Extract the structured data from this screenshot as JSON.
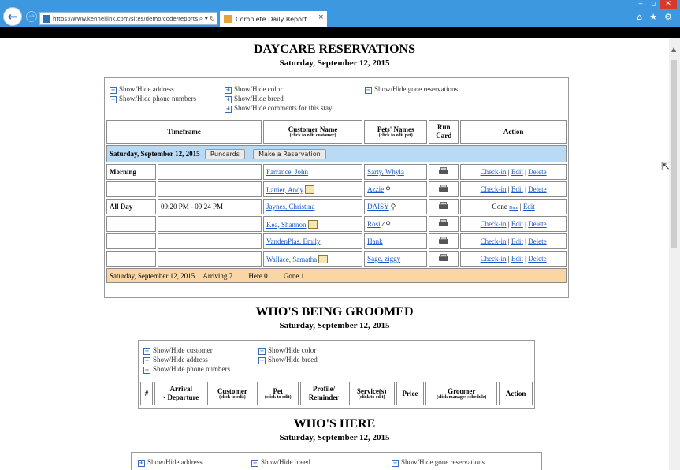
{
  "browser": {
    "url": "https://www.kennellink.com/sites/demo/code/reports...",
    "tab_title": "Complete Daily Report",
    "addr_controls": "⌕ ▾ ↻",
    "tab_close": "×",
    "win_min": "‒",
    "win_max": "▫",
    "win_close": "✕",
    "back": "←",
    "fwd": "→",
    "home": "⌂",
    "star": "★",
    "gear": "⚙"
  },
  "reservations": {
    "title": "DAYCARE RESERVATIONS",
    "date": "Saturday, September 12, 2015",
    "toggles": {
      "address": "Show/Hide address",
      "phone": "Show/Hide phone numbers",
      "color": "Show/Hide color",
      "breed": "Show/Hide breed",
      "comments": "Show/Hide comments for this stay",
      "gone": "Show/Hide gone reservations"
    },
    "headers": {
      "timeframe": "Timeframe",
      "customer": "Customer Name",
      "customer_sub": "(click to edit customer)",
      "pets": "Pets' Names",
      "pets_sub": "(click to edit pet)",
      "run_card": "Run Card",
      "action": "Action"
    },
    "day_label": "Saturday, September 12, 2015",
    "runcards_button": "Runcards",
    "make_reservation_button": "Make a Reservation",
    "rows": [
      {
        "period": "Morning",
        "time": "",
        "customer": "Farrance, John",
        "pets": "Sarty, Whyla",
        "action": "checkin"
      },
      {
        "period": "",
        "time": "",
        "customer": "Lanier, Andy",
        "pets": "Azzie",
        "action": "checkin"
      },
      {
        "period": "All Day",
        "time": "09:20 PM - 09:24 PM",
        "customer": "Jaynes, Christina",
        "pets": "DAISY",
        "action": "gone"
      },
      {
        "period": "",
        "time": "",
        "customer": "Kea, Shannon",
        "pets": "Rosi",
        "action": "checkin"
      },
      {
        "period": "",
        "time": "",
        "customer": "VandenPlas, Emily",
        "pets": "Hank",
        "action": "checkin"
      },
      {
        "period": "",
        "time": "",
        "customer": "Wallace, Samatha",
        "pets": "Sage, ziggy",
        "action": "checkin"
      }
    ],
    "actions": {
      "checkin": "Check-in",
      "edit": "Edit",
      "delete": "Delete",
      "gone": "Gone",
      "date": "Date",
      "sep": "|"
    },
    "footer": {
      "date": "Saturday, September 12, 2015",
      "arriving": "Arriving 7",
      "here": "Here 0",
      "gone": "Gone 1"
    }
  },
  "grooming": {
    "title": "WHO'S BEING GROOMED",
    "date": "Saturday, September 12, 2015",
    "toggles": {
      "customer": "Show/Hide customer",
      "address": "Show/Hide address",
      "phone": "Show/Hide phone numbers",
      "color": "Show/Hide color",
      "breed": "Show/Hide breed"
    },
    "headers": {
      "num": "#",
      "arrival": "Arrival",
      "departure": "- Departure",
      "customer": "Customer",
      "customer_sub": "(click to edit)",
      "pet": "Pet",
      "pet_sub": "(click to edit)",
      "profile": "Profile/",
      "reminder": "Reminder",
      "services": "Service(s)",
      "services_sub": "(click to edit)",
      "price": "Price",
      "groomer": "Groomer",
      "groomer_sub": "(click manages schedule)",
      "action": "Action"
    }
  },
  "here": {
    "title": "WHO'S HERE",
    "date": "Saturday, September 12, 2015",
    "toggles": {
      "address": "Show/Hide address",
      "breed": "Show/Hide breed",
      "gone": "Show/Hide gone reservations"
    }
  }
}
